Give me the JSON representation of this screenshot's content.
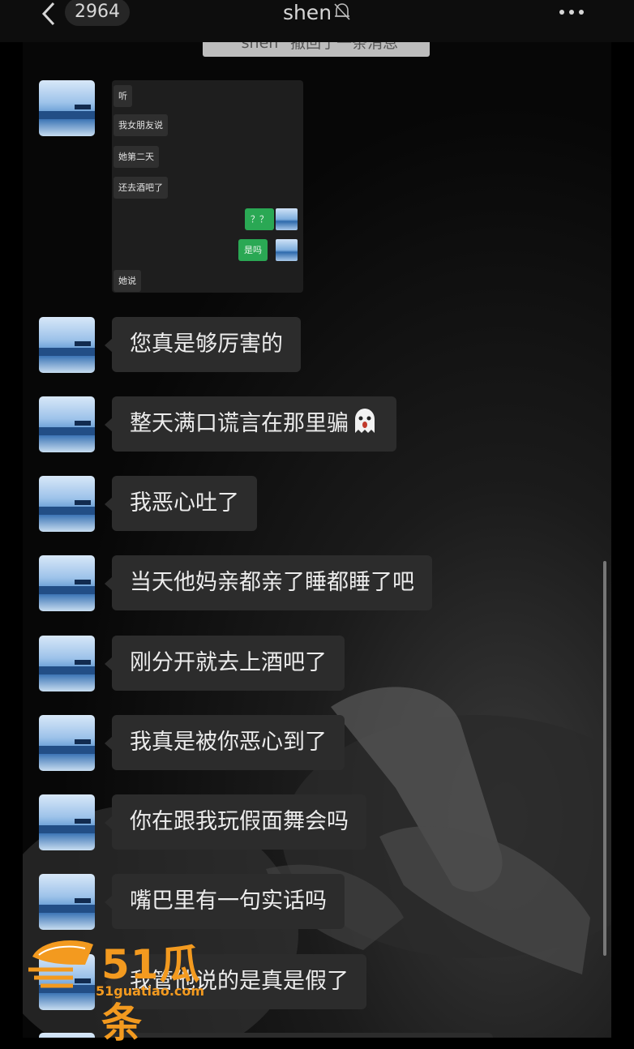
{
  "header": {
    "unread_count": "2964",
    "title": "shen",
    "icons": {
      "back": "chevron-left-icon",
      "mute": "bell-slash-icon",
      "more": "more-dots-icon"
    }
  },
  "system_notice": "\"shen\" 撤回了一条消息",
  "screenshot": {
    "messages": [
      {
        "from": "other",
        "text": "听"
      },
      {
        "from": "other",
        "text": "我女朋友说"
      },
      {
        "from": "other",
        "text": "她第二天"
      },
      {
        "from": "other",
        "text": "还去酒吧了"
      },
      {
        "from": "self",
        "text": "？？"
      },
      {
        "from": "self",
        "text": "是吗"
      },
      {
        "from": "other",
        "text": "她说"
      }
    ]
  },
  "messages": [
    {
      "text": "您真是够厉害的"
    },
    {
      "text": "整天满口谎言在那里骗",
      "emoji": "ghost-emoji"
    },
    {
      "text": "我恶心吐了"
    },
    {
      "text": "当天他妈亲都亲了睡都睡了吧"
    },
    {
      "text": "刚分开就去上酒吧了"
    },
    {
      "text": "我真是被你恶心到了"
    },
    {
      "text": "你在跟我玩假面舞会吗"
    },
    {
      "text": "嘴巴里有一句实话吗"
    },
    {
      "text": "我管他说的是真是假了"
    }
  ],
  "watermark": {
    "logo": "51瓜条",
    "url": "51guatiao.com"
  },
  "colors": {
    "bubble": "#2c2c2c",
    "self_bubble": "#2aa854",
    "watermark": "#f39a1f"
  }
}
